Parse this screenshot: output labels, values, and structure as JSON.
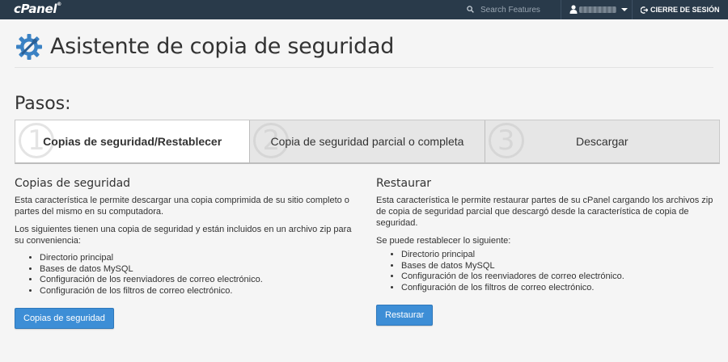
{
  "topbar": {
    "logo": "cPanel",
    "logo_mark": "®",
    "search_placeholder": "Search Features",
    "logout_label": "CIERRE DE SESIÓN",
    "bg_color": "#293a4a"
  },
  "header": {
    "title": "Asistente de copia de seguridad"
  },
  "steps": {
    "heading": "Pasos:",
    "items": [
      {
        "number": "1",
        "label": "Copias de seguridad/Restablecer",
        "active": true
      },
      {
        "number": "2",
        "label": "Copia de seguridad parcial o completa",
        "active": false
      },
      {
        "number": "3",
        "label": "Descargar",
        "active": false
      }
    ]
  },
  "backup": {
    "title": "Copias de seguridad",
    "description": "Esta característica le permite descargar una copia comprimida de su sitio completo o partes del mismo en su computadora.",
    "included_intro": "Los siguientes tienen una copia de seguridad y están incluidos en un archivo zip para su conveniencia:",
    "items": [
      "Directorio principal",
      "Bases de datos MySQL",
      "Configuración de los reenviadores de correo electrónico.",
      "Configuración de los filtros de correo electrónico."
    ],
    "button_label": "Copias de seguridad"
  },
  "restore": {
    "title": "Restaurar",
    "description": "Esta característica le permite restaurar partes de su cPanel cargando los archivos zip de copia de seguridad parcial que descargó desde la característica de copia de seguridad.",
    "restorable_intro": "Se puede restablecer lo siguiente:",
    "items": [
      "Directorio principal",
      "Bases de datos MySQL",
      "Configuración de los reenviadores de correo electrónico.",
      "Configuración de los filtros de correo electrónico."
    ],
    "button_label": "Restaurar"
  },
  "colors": {
    "accent": "#3d8ed6",
    "icon_blue": "#3b82c4"
  }
}
